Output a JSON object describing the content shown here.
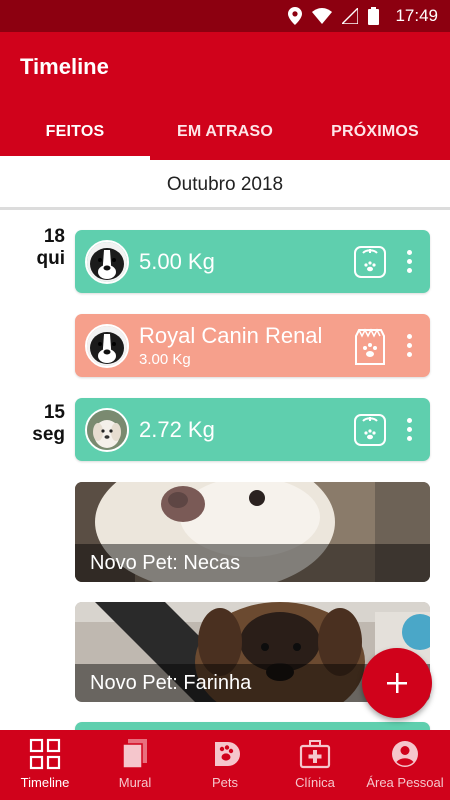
{
  "status_bar": {
    "time": "17:49",
    "icons": [
      "location-icon",
      "wifi-icon",
      "signal-icon",
      "battery-icon"
    ]
  },
  "app": {
    "title": "Timeline"
  },
  "tabs": [
    {
      "label": "FEITOS",
      "active": true
    },
    {
      "label": "EM ATRASO",
      "active": false
    },
    {
      "label": "PRÓXIMOS",
      "active": false
    }
  ],
  "month": "Outubro 2018",
  "days": [
    {
      "day": "18",
      "weekday": "qui"
    },
    {
      "day": "15",
      "weekday": "seg"
    }
  ],
  "timeline": [
    {
      "type": "weight",
      "color": "#5fcfae",
      "main": "5.00 Kg",
      "icon": "scale-icon"
    },
    {
      "type": "food",
      "color": "#f6a08c",
      "main": "Royal Canin Renal",
      "sub": "3.00 Kg",
      "icon": "food-bag-icon"
    },
    {
      "type": "weight",
      "color": "#5fcfae",
      "main": "2.72 Kg",
      "icon": "scale-icon"
    },
    {
      "type": "new-pet",
      "caption": "Novo Pet: Necas"
    },
    {
      "type": "new-pet",
      "caption": "Novo Pet: Farinha"
    }
  ],
  "fab": {
    "icon": "plus-icon"
  },
  "bottom_nav": [
    {
      "label": "Timeline",
      "icon": "grid-icon",
      "active": true
    },
    {
      "label": "Mural",
      "icon": "pages-icon",
      "active": false
    },
    {
      "label": "Pets",
      "icon": "paw-icon",
      "active": false
    },
    {
      "label": "Clínica",
      "icon": "first-aid-icon",
      "active": false
    },
    {
      "label": "Área Pessoal",
      "icon": "account-icon",
      "active": false
    }
  ],
  "colors": {
    "primary": "#d0021b",
    "status_bar": "#8c0010",
    "weight_card": "#5fcfae",
    "food_card": "#f6a08c"
  }
}
